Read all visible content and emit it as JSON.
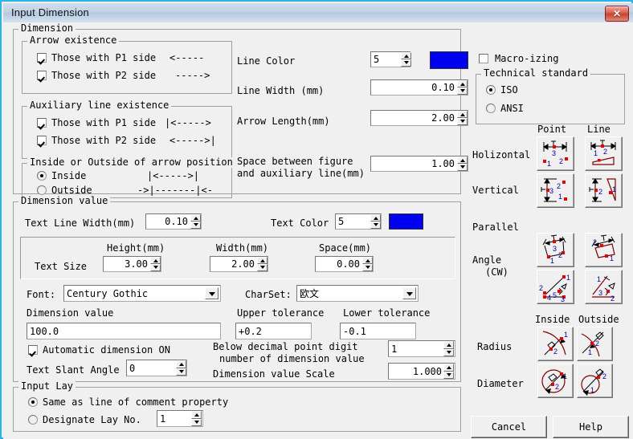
{
  "window": {
    "title": "Input Dimension",
    "close_label": "✕",
    "border_color": "#29b6e6"
  },
  "dimension": {
    "legend": "Dimension",
    "arrow_existence": {
      "legend": "Arrow existence",
      "p1_label": "Those with P1 side",
      "p1_art": "<-----",
      "p1_checked": true,
      "p2_label": "Those with P2 side",
      "p2_art": "----->",
      "p2_checked": true
    },
    "auxiliary": {
      "legend": "Auxiliary line existence",
      "p1_label": "Those with P1 side",
      "p1_art": "|<----->",
      "p1_checked": true,
      "p2_label": "Those with P2 side",
      "p2_art": "<----->|",
      "p2_checked": true
    },
    "inside_outside": {
      "legend": "Inside or Outside of arrow position",
      "inside_label": "Inside",
      "inside_art": "|<----->|",
      "outside_label": "Outside",
      "outside_art": "->|-------|<-",
      "selected": "Inside"
    },
    "line_color_label": "Line Color",
    "line_color_value": "5",
    "line_color_swatch": "#0000f0",
    "line_width_label": "Line Width (mm)",
    "line_width_value": "0.10",
    "arrow_length_label": "Arrow Length(mm)",
    "arrow_length_value": "2.00",
    "space_label_line1": "Space between figure",
    "space_label_line2": "and auxiliary line(mm)",
    "space_value": "1.00"
  },
  "dimension_value": {
    "legend": "Dimension value",
    "text_line_width_label": "Text Line Width(mm)",
    "text_line_width_value": "0.10",
    "text_color_label": "Text Color",
    "text_color_value": "5",
    "text_color_swatch": "#0000f0",
    "text_size_label": "Text Size",
    "height_label": "Height(mm)",
    "height_value": "3.00",
    "width_label": "Width(mm)",
    "width_value": "2.00",
    "space_label": "Space(mm)",
    "space_value": "0.00",
    "font_label": "Font:",
    "font_value": "Century Gothic",
    "charset_label": "CharSet:",
    "charset_value": "欧文",
    "dim_value_label": "Dimension value",
    "dim_value": "100.0",
    "upper_tol_label": "Upper tolerance",
    "upper_tol_value": "+0.2",
    "lower_tol_label": "Lower tolerance",
    "lower_tol_value": "-0.1",
    "auto_dim_label": "Automatic dimension ON",
    "auto_dim_checked": true,
    "slant_label": "Text Slant Angle",
    "slant_value": "0",
    "decimal_label_line1": "Below decimal point digit",
    "decimal_label_line2": "number of dimension value",
    "decimal_value": "1",
    "scale_label": "Dimension value Scale",
    "scale_value": "1.000"
  },
  "input_lay": {
    "legend": "Input Lay",
    "same_label": "Same as line of comment property",
    "designate_label": "Designate Lay No.",
    "designate_value": "1",
    "selected": "Same as line of comment property"
  },
  "right_panel": {
    "macro_label": "Macro-izing",
    "macro_checked": false,
    "tech_standard": {
      "legend": "Technical standard",
      "iso_label": "ISO",
      "ansi_label": "ANSI",
      "selected": "ISO"
    },
    "col_point": "Point",
    "col_line": "Line",
    "row_horizontal": "Holizontal",
    "row_vertical": "Vertical",
    "row_parallel": "Parallel",
    "row_angle_l1": "Angle",
    "row_angle_l2": "(CW)",
    "col_inside": "Inside",
    "col_outside": "Outside",
    "row_radius": "Radius",
    "row_diameter": "Diameter"
  },
  "buttons": {
    "cancel": "Cancel",
    "help": "Help"
  }
}
